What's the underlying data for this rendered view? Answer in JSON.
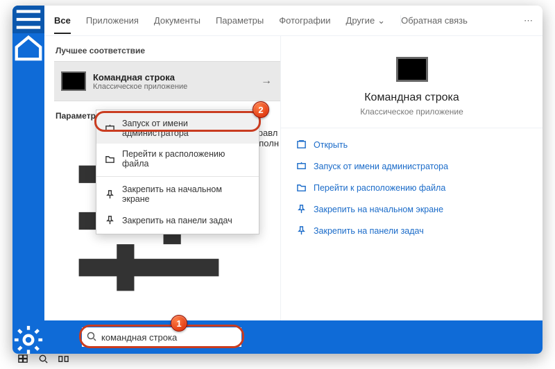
{
  "tabs": {
    "items": [
      "Все",
      "Приложения",
      "Документы",
      "Параметры",
      "Фотографии",
      "Другие"
    ],
    "feedback": "Обратная связь"
  },
  "left": {
    "best_header": "Лучшее соответствие",
    "best_title": "Командная строка",
    "best_sub": "Классическое приложение",
    "params_header": "Параметры",
    "param1_line1": "Управл",
    "param1_line2": "выполн"
  },
  "ctx": {
    "run_admin": "Запуск от имени администратора",
    "open_location": "Перейти к расположению файла",
    "pin_start": "Закрепить на начальном экране",
    "pin_taskbar": "Закрепить на панели задач"
  },
  "preview": {
    "title": "Командная строка",
    "sub": "Классическое приложение"
  },
  "actions": {
    "open": "Открыть",
    "run_admin": "Запуск от имени администратора",
    "open_location": "Перейти к расположению файла",
    "pin_start": "Закрепить на начальном экране",
    "pin_taskbar": "Закрепить на панели задач"
  },
  "search": {
    "value": "командная строка"
  },
  "markers": {
    "m1": "1",
    "m2": "2"
  }
}
